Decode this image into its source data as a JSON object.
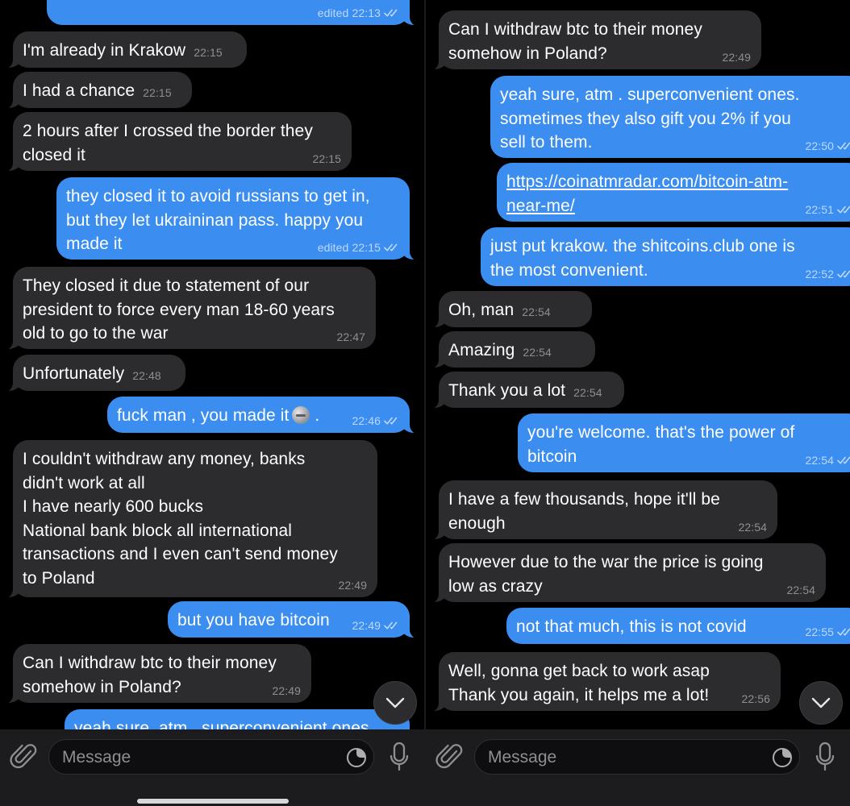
{
  "colors": {
    "incoming_bubble": "#2c2c2e",
    "outgoing_bubble": "#3b8ef0",
    "background": "#000000",
    "input_bar": "#1c1c1e"
  },
  "input": {
    "placeholder": "Message"
  },
  "icons": {
    "attach": "paperclip-icon",
    "sticker": "sticker-icon",
    "voice": "microphone-icon",
    "scroll": "chevron-down-icon",
    "read": "double-check-icon"
  },
  "left_messages": [
    {
      "dir": "out",
      "lines": [
        ""
      ],
      "time": "22:13",
      "edited": true,
      "read": true
    },
    {
      "dir": "in",
      "lines": [
        "I'm already in Krakow"
      ],
      "time": "22:15"
    },
    {
      "dir": "in",
      "lines": [
        "I had a chance"
      ],
      "time": "22:15"
    },
    {
      "dir": "in",
      "lines": [
        "2 hours after I crossed the border they",
        "closed it"
      ],
      "time": "22:15"
    },
    {
      "dir": "out",
      "lines": [
        "they closed it to avoid russians to get in,",
        "but they let ukraininan pass. happy you",
        "made it"
      ],
      "time": "22:15",
      "edited": true,
      "read": true
    },
    {
      "dir": "in",
      "lines": [
        "They closed it due to statement of our",
        "president to force every man 18-60 years",
        "old to go to the war"
      ],
      "time": "22:47"
    },
    {
      "dir": "in",
      "lines": [
        "Unfortunately"
      ],
      "time": "22:48"
    },
    {
      "dir": "out",
      "lines": [
        "fuck man , you made it"
      ],
      "suffix": " .",
      "time": "22:46",
      "read": true
    },
    {
      "dir": "in",
      "lines": [
        "I couldn't withdraw any money, banks",
        "didn't work at all",
        "I have nearly 600 bucks",
        "National bank block all international",
        "transactions and I even can't send money",
        "to Poland"
      ],
      "time": "22:49"
    },
    {
      "dir": "out",
      "lines": [
        "but you have bitcoin"
      ],
      "time": "22:49",
      "read": true
    },
    {
      "dir": "in",
      "lines": [
        "Can I withdraw btc to their money",
        "somehow in Poland?"
      ],
      "time": "22:49"
    },
    {
      "dir": "out",
      "lines": [
        "yeah sure, atm . superconvenient ones."
      ],
      "time": "",
      "read": false
    }
  ],
  "right_messages": [
    {
      "dir": "in",
      "lines": [
        "Can I withdraw btc to their money",
        "somehow in Poland?"
      ],
      "time": "22:49"
    },
    {
      "dir": "out",
      "lines": [
        "yeah sure, atm . superconvenient ones.",
        "sometimes they also gift you 2% if you",
        "sell to them."
      ],
      "time": "22:50",
      "read": true
    },
    {
      "dir": "out",
      "lines": [
        "https://coinatmradar.com/bitcoin-atm-",
        "near-me/"
      ],
      "link": true,
      "time": "22:51",
      "read": true
    },
    {
      "dir": "out",
      "lines": [
        "just put krakow. the shitcoins.club one is",
        "the most convenient."
      ],
      "time": "22:52",
      "read": true
    },
    {
      "dir": "in",
      "lines": [
        "Oh, man"
      ],
      "time": "22:54"
    },
    {
      "dir": "in",
      "lines": [
        "Amazing"
      ],
      "time": "22:54"
    },
    {
      "dir": "in",
      "lines": [
        "Thank you a lot"
      ],
      "time": "22:54"
    },
    {
      "dir": "out",
      "lines": [
        "you're welcome. that's the power of",
        "bitcoin"
      ],
      "time": "22:54",
      "read": true
    },
    {
      "dir": "in",
      "lines": [
        "I have a few thousands, hope it'll be",
        "enough"
      ],
      "time": "22:54"
    },
    {
      "dir": "in",
      "lines": [
        "However due to the war the price is going",
        "low as crazy"
      ],
      "time": "22:54"
    },
    {
      "dir": "out",
      "lines": [
        "not that much, this is not covid"
      ],
      "time": "22:55",
      "read": true
    },
    {
      "dir": "in",
      "lines": [
        "Well, gonna get back to work asap",
        "Thank you again, it helps me a lot!"
      ],
      "time": "22:56"
    }
  ],
  "edited_label": "edited"
}
